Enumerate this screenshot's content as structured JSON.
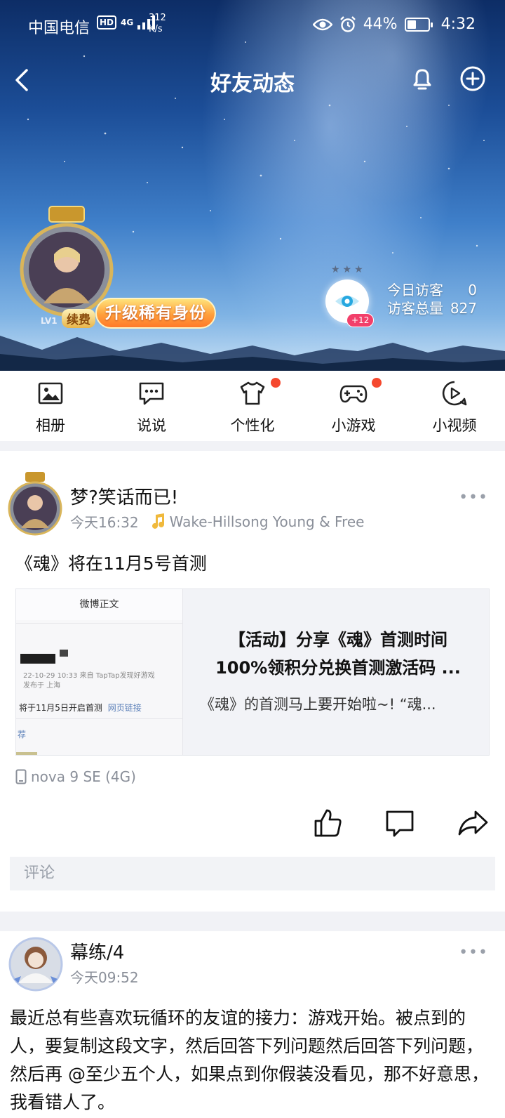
{
  "status_bar": {
    "carrier": "中国电信",
    "hd": "HD",
    "network": "4G",
    "speed_value": "312",
    "speed_unit": "K/s",
    "battery_percent": "44%",
    "battery_level": 0.44,
    "time": "4:32"
  },
  "nav": {
    "title": "好友动态",
    "icons": [
      "back-arrow-icon",
      "bell-icon",
      "plus-circle-icon"
    ]
  },
  "profile": {
    "level": "LV1",
    "renew_label": "续费",
    "upgrade_label": "升级稀有身份",
    "visitor_plus": "+12",
    "today_visitors_label": "今日访客",
    "today_visitors_value": "0",
    "total_visitors_label": "访客总量",
    "total_visitors_value": "827"
  },
  "menu": [
    {
      "label": "相册",
      "icon": "photo-album-icon",
      "dot": false
    },
    {
      "label": "说说",
      "icon": "chat-bubble-icon",
      "dot": false
    },
    {
      "label": "个性化",
      "icon": "tshirt-icon",
      "dot": true
    },
    {
      "label": "小游戏",
      "icon": "gamepad-icon",
      "dot": true
    },
    {
      "label": "小视频",
      "icon": "play-video-icon",
      "dot": false
    }
  ],
  "posts": [
    {
      "author": "梦?笑话而已!",
      "time": "今天16:32",
      "music": "Wake-Hillsong Young & Free",
      "text": "《魂》将在11月5号首测",
      "link": {
        "thumb_header": "微博正文",
        "thumb_date": "22-10-29 10:33  来自 TapTap发现好游戏",
        "thumb_location": "发布于 上海",
        "thumb_line": "将于11月5日开启首测",
        "thumb_link": "网页链接",
        "thumb_tail": "荐",
        "title_line1": "【活动】分享《魂》首测时间",
        "title_line2": "100%领积分兑换首测激活码 ...",
        "desc": "《魂》的首测马上要开始啦~! “魂..."
      },
      "device": "nova 9 SE (4G)",
      "comment_placeholder": "评论"
    },
    {
      "author": "幕练/4",
      "time": "今天09:52",
      "text": "最近总有些喜欢玩循环的友谊的接力：游戏开始。被点到的人，要复制这段文字，然后回答下列问题然后回答下列问题，然后再 @至少五个人，如果点到你假装没看见，那不好意思，我看错人了。"
    }
  ],
  "colors": {
    "notification_dot": "#f5482e",
    "badge_pink": "#f23f6a",
    "upgrade_orange": "#ff9f3b",
    "gap_gray": "#f1f2f6"
  }
}
